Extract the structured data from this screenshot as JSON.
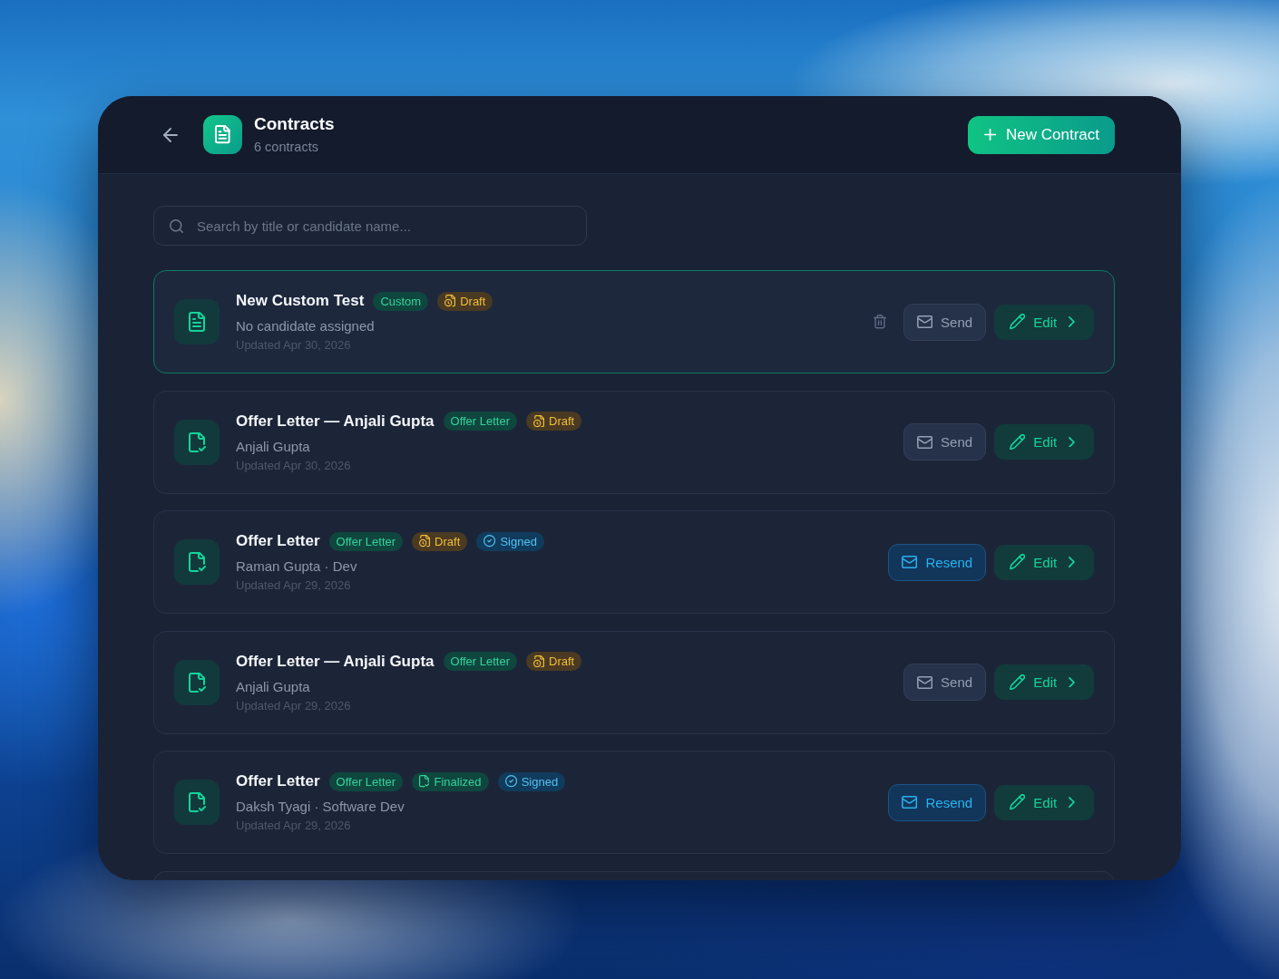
{
  "window": {
    "title": "Contracts",
    "subtitle": "6 contracts"
  },
  "header": {
    "new_button": "New Contract"
  },
  "search": {
    "placeholder": "Search by title or candidate name..."
  },
  "contracts": [
    {
      "kind": "custom",
      "title": "New Custom Test",
      "selected": true,
      "badges": [
        {
          "kind": "type",
          "label": "Custom"
        },
        {
          "kind": "draft",
          "label": "Draft"
        }
      ],
      "candidate": "No candidate assigned",
      "updated": "Updated Apr 30, 2026",
      "deletable": true,
      "send": {
        "kind": "send",
        "label": "Send"
      },
      "edit": "Edit"
    },
    {
      "kind": "offer",
      "title": "Offer Letter — Anjali Gupta",
      "selected": false,
      "badges": [
        {
          "kind": "type",
          "label": "Offer Letter"
        },
        {
          "kind": "draft",
          "label": "Draft"
        }
      ],
      "candidate": "Anjali Gupta",
      "updated": "Updated Apr 30, 2026",
      "deletable": false,
      "send": {
        "kind": "send",
        "label": "Send"
      },
      "edit": "Edit"
    },
    {
      "kind": "offer",
      "title": "Offer Letter",
      "selected": false,
      "badges": [
        {
          "kind": "type",
          "label": "Offer Letter"
        },
        {
          "kind": "draft",
          "label": "Draft"
        },
        {
          "kind": "signed",
          "label": "Signed"
        }
      ],
      "candidate": "Raman Gupta · Dev",
      "updated": "Updated Apr 29, 2026",
      "deletable": false,
      "send": {
        "kind": "resend",
        "label": "Resend"
      },
      "edit": "Edit"
    },
    {
      "kind": "offer",
      "title": "Offer Letter — Anjali Gupta",
      "selected": false,
      "badges": [
        {
          "kind": "type",
          "label": "Offer Letter"
        },
        {
          "kind": "draft",
          "label": "Draft"
        }
      ],
      "candidate": "Anjali Gupta",
      "updated": "Updated Apr 29, 2026",
      "deletable": false,
      "send": {
        "kind": "send",
        "label": "Send"
      },
      "edit": "Edit"
    },
    {
      "kind": "offer",
      "title": "Offer Letter",
      "selected": false,
      "badges": [
        {
          "kind": "type",
          "label": "Offer Letter"
        },
        {
          "kind": "finalized",
          "label": "Finalized"
        },
        {
          "kind": "signed",
          "label": "Signed"
        }
      ],
      "candidate": "Daksh Tyagi · Software Dev",
      "updated": "Updated Apr 29, 2026",
      "deletable": false,
      "send": {
        "kind": "resend",
        "label": "Resend"
      },
      "edit": "Edit"
    }
  ]
}
